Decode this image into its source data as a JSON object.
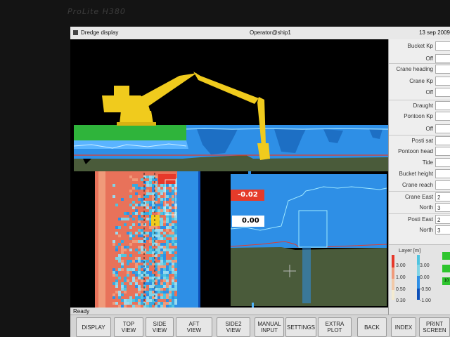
{
  "monitor_brand": "ProLite H380",
  "window": {
    "title": "Dredge display",
    "user": "Operator@ship1",
    "date": "13 sep 2009"
  },
  "side_panel": {
    "rows": [
      {
        "label": "Bucket Kp",
        "value": ""
      },
      {
        "label": "Off",
        "value": ""
      },
      {
        "label": "Crane heading",
        "value": ""
      },
      {
        "label": "Crane Kp",
        "value": ""
      },
      {
        "label": "Off",
        "value": ""
      },
      {
        "label": "Draught",
        "value": ""
      },
      {
        "label": "Pontoon Kp",
        "value": ""
      },
      {
        "label": "Off",
        "value": ""
      },
      {
        "label": "Posti sat",
        "value": ""
      },
      {
        "label": "Pontoon head",
        "value": ""
      },
      {
        "label": "Tide",
        "value": ""
      },
      {
        "label": "Bucket height",
        "value": ""
      },
      {
        "label": "Crane reach",
        "value": ""
      },
      {
        "label": "Crane East",
        "value": "2"
      },
      {
        "label": "North",
        "value": "3"
      },
      {
        "label": "Posti East",
        "value": "2"
      },
      {
        "label": "North",
        "value": "3"
      }
    ],
    "legend": {
      "title": "Layer [m]",
      "left_ticks": [
        "3.00",
        "1.00",
        "0.50",
        "0.30"
      ],
      "right_ticks": [
        "3.00",
        "0.00",
        "-0.50",
        "-1.00"
      ]
    },
    "indicators": [
      "",
      "",
      "10"
    ]
  },
  "readouts": {
    "depth_red": "-0.02",
    "depth_white": "0.00"
  },
  "status": "Ready",
  "buttons": [
    {
      "label": "DISPLAY"
    },
    {
      "label": "TOP\nVIEW"
    },
    {
      "label": "SIDE\nVIEW"
    },
    {
      "label": "AFT\nVIEW"
    },
    {
      "label": "SIDE2\nVIEW"
    },
    {
      "label": "MANUAL\nINPUT"
    },
    {
      "label": "SETTINGS"
    },
    {
      "label": "EXTRA\nPLOT"
    },
    {
      "label": "BACK"
    },
    {
      "label": "INDEX"
    },
    {
      "label": "PRINT\nSCREEN"
    }
  ],
  "colors": {
    "water": "#2e8fe6",
    "seabed": "#4a5b3a",
    "grass": "#2fb43b",
    "crane": "#f0cb1d",
    "target_line": "#e53b2a",
    "profile_line": "#9fe8ff",
    "bathy_red": "#e8725a",
    "bathy_blue": "#37a9e0"
  }
}
